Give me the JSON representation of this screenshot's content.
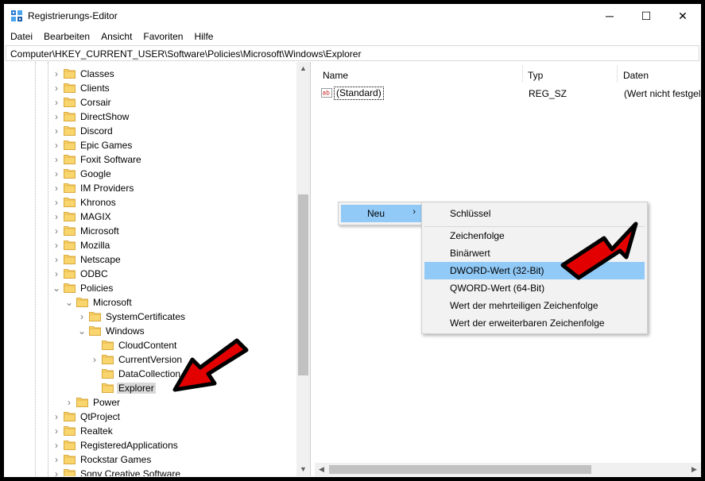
{
  "window": {
    "title": "Registrierungs-Editor",
    "minimize": "─",
    "maximize": "☐",
    "close": "✕"
  },
  "menu": [
    "Datei",
    "Bearbeiten",
    "Ansicht",
    "Favoriten",
    "Hilfe"
  ],
  "address": "Computer\\HKEY_CURRENT_USER\\Software\\Policies\\Microsoft\\Windows\\Explorer",
  "tree": {
    "software_children": [
      "Classes",
      "Clients",
      "Corsair",
      "DirectShow",
      "Discord",
      "Epic Games",
      "Foxit Software",
      "Google",
      "IM Providers",
      "Khronos",
      "MAGIX",
      "Microsoft",
      "Mozilla",
      "Netscape",
      "ODBC",
      "Policies"
    ],
    "policies_children": [
      "Microsoft"
    ],
    "microsoft_children": [
      "SystemCertificates",
      "Windows"
    ],
    "windows_children": [
      "CloudContent",
      "CurrentVersion",
      "DataCollection",
      "Explorer"
    ],
    "after_microsoft": [
      "Power"
    ],
    "after_policies": [
      "QtProject",
      "Realtek",
      "RegisteredApplications",
      "Rockstar Games",
      "Sony Creative Software"
    ],
    "selected": "Explorer"
  },
  "values": {
    "columns": [
      "Name",
      "Typ",
      "Daten"
    ],
    "rows": [
      {
        "name": "(Standard)",
        "type": "REG_SZ",
        "data": "(Wert nicht festgelegt)",
        "icon": "string-value-icon"
      }
    ]
  },
  "context_menu": {
    "new_label": "Neu",
    "submenu_arrow": "›",
    "submenu": {
      "key": "Schlüssel",
      "items": [
        "Zeichenfolge",
        "Binärwert",
        "DWORD-Wert (32-Bit)",
        "QWORD-Wert (64-Bit)",
        "Wert der mehrteiligen Zeichenfolge",
        "Wert der erweiterbaren Zeichenfolge"
      ],
      "highlighted": "DWORD-Wert (32-Bit)"
    }
  },
  "colors": {
    "highlight": "#91c9f7",
    "selection": "#d9d9d9",
    "annotation_arrow": "#e30000"
  }
}
